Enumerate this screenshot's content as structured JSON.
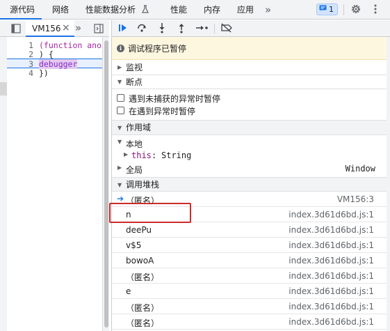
{
  "top_tabs": {
    "sources": "源代码",
    "network": "网络",
    "performance_insights": "性能数据分析",
    "performance": "性能",
    "memory": "内存",
    "application": "应用",
    "more": "»",
    "issues_count": "1"
  },
  "file_tab": {
    "name": "VM156",
    "close": "×",
    "more": "»"
  },
  "code_lines": [
    {
      "num": "1",
      "text": "(function anonymous("
    },
    {
      "num": "2",
      "text": ") {"
    },
    {
      "num": "3",
      "text": "debugger"
    },
    {
      "num": "4",
      "text": "})"
    }
  ],
  "paused_banner": {
    "icon": "i",
    "text": "调试程序已暂停"
  },
  "sections": {
    "watch": "监视",
    "breakpoints": "断点",
    "scope": "作用域",
    "call_stack": "调用堆栈"
  },
  "breakpoint_options": [
    "遇到未捕获的异常时暂停",
    "在遇到异常时暂停"
  ],
  "scope": {
    "local": "本地",
    "this_label": "this",
    "this_sep": ": ",
    "this_value": "String",
    "global": "全局",
    "global_value": "Window"
  },
  "call_stack": [
    {
      "name": "（匿名）",
      "location": "VM156:3"
    },
    {
      "name": "n",
      "location": "index.3d61d6bd.js:1"
    },
    {
      "name": "deePu",
      "location": "index.3d61d6bd.js:1"
    },
    {
      "name": "v$5",
      "location": "index.3d61d6bd.js:1"
    },
    {
      "name": "bowoA",
      "location": "index.3d61d6bd.js:1"
    },
    {
      "name": "（匿名）",
      "location": "index.3d61d6bd.js:1"
    },
    {
      "name": "e",
      "location": "index.3d61d6bd.js:1"
    },
    {
      "name": "（匿名）",
      "location": "index.3d61d6bd.js:1"
    },
    {
      "name": "（匿名）",
      "location": "index.3d61d6bd.js:1"
    }
  ],
  "colors": {
    "accent": "#1a73e8",
    "highlight_box": "#cc2b2b",
    "paused_bg": "#fef7e0"
  }
}
